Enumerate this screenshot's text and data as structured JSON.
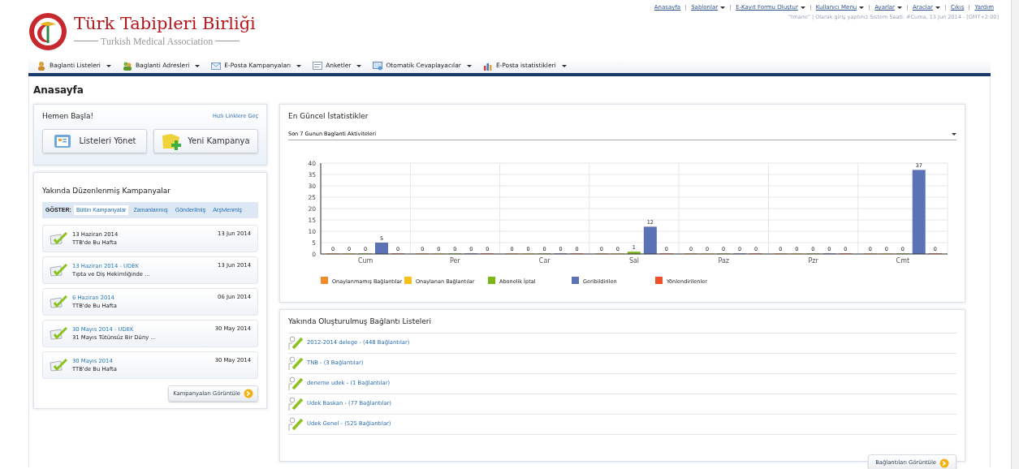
{
  "header": {
    "logo_title": "Türk Tabipleri Birliği",
    "logo_subtitle": "Turkish Medical Association",
    "top_links": [
      {
        "label": "Anasayfa",
        "dropdown": false
      },
      {
        "label": "Sablonlar",
        "dropdown": true
      },
      {
        "label": "E-Kayıt Formu Oluştur",
        "dropdown": true
      },
      {
        "label": "Kullanıcı Menu",
        "dropdown": true
      },
      {
        "label": "Ayarlar",
        "dropdown": true
      },
      {
        "label": "Araclar",
        "dropdown": true
      },
      {
        "label": "Çıkış",
        "dropdown": false
      },
      {
        "label": "Yardım",
        "dropdown": false
      }
    ],
    "session_info": "\"tmane\" | Olarak giriş yaptınız Sistem Saati: #Cuma, 13 Jun 2014 - [GMT+2:00]"
  },
  "nav": [
    {
      "label": "Baglanti Listeleri",
      "kind": "person"
    },
    {
      "label": "Baglanti Adresleri",
      "kind": "people"
    },
    {
      "label": "E-Posta Kampanyaları",
      "kind": "mail"
    },
    {
      "label": "Anketler",
      "kind": "form"
    },
    {
      "label": "Otomatik Cevaplayacılar",
      "kind": "auto"
    },
    {
      "label": "E-Posta istatistikleri",
      "kind": "chart"
    }
  ],
  "page_title": "Anasayfa",
  "quick_start": {
    "title": "Hemen Başla!",
    "link": "Hızlı Linklere Geç",
    "buttons": [
      {
        "label": "Listeleri Yönet",
        "kind": "folder"
      },
      {
        "label": "Yeni Kampanya",
        "kind": "add"
      }
    ]
  },
  "campaigns": {
    "title": "Yakında Düzenlenmiş Kampanyalar",
    "filter_label": "GÖSTER:",
    "filters": [
      {
        "label": "Bütün Kampanyalar",
        "selected": true
      },
      {
        "label": "Zamanlanmış",
        "selected": false
      },
      {
        "label": "Gönderilmiş",
        "selected": false
      },
      {
        "label": "Arşivlenmiş",
        "selected": false
      }
    ],
    "items": [
      {
        "title": "13 Haziran 2014",
        "subtitle": "TTB'de Bu Hafta",
        "date": "13 Jun 2014",
        "linked": false
      },
      {
        "title": "13 Haziran 2014 - UDEK",
        "subtitle": "Tıpta ve Diş Hekimliğinde ...",
        "date": "13 Jun 2014",
        "linked": true
      },
      {
        "title": "6 Haziran 2014",
        "subtitle": "TTB'de Bu Hafta",
        "date": "06 Jun 2014",
        "linked": true
      },
      {
        "title": "30 Mayıs 2014 - UDEK",
        "subtitle": "31 Mayıs Tütünsüz Bir Düny ...",
        "date": "30 May 2014",
        "linked": true
      },
      {
        "title": "30 Mayıs 2014",
        "subtitle": "TTB'de Bu Hafta",
        "date": "30 May 2014",
        "linked": true
      }
    ],
    "button": "Kampanyaları Görüntüle"
  },
  "stats": {
    "title": "En Güncel İstatistikler",
    "select": "Son 7 Gunun Baglanti Aktiviteleri",
    "chart_data": {
      "type": "bar",
      "categories": [
        "Cum",
        "Per",
        "Car",
        "Sal",
        "Paz",
        "Pzr",
        "Cmt"
      ],
      "series": [
        {
          "name": "Onaylanmamış Bağlantılar",
          "color": "#f28c28",
          "values": [
            0,
            0,
            0,
            0,
            0,
            0,
            0
          ]
        },
        {
          "name": "Onaylanan Bağlantılar",
          "color": "#f5c11a",
          "values": [
            0,
            0,
            0,
            0,
            0,
            0,
            0
          ]
        },
        {
          "name": "Abonelik İptal",
          "color": "#7cb518",
          "values": [
            0,
            0,
            0,
            1,
            0,
            0,
            0
          ]
        },
        {
          "name": "Geribildirilen",
          "color": "#5b73b5",
          "values": [
            5,
            0,
            0,
            12,
            0,
            0,
            37
          ]
        },
        {
          "name": "Yönlendirilenler",
          "color": "#f0502a",
          "values": [
            0,
            0,
            0,
            0,
            0,
            0,
            0
          ]
        }
      ],
      "ylim": [
        0,
        40
      ],
      "yticks": [
        0,
        5,
        10,
        15,
        20,
        25,
        30,
        35,
        40
      ],
      "data_labels": true,
      "grid": true,
      "legend": true
    }
  },
  "lists": {
    "title": "Yakında Oluşturulmuş Bağlantı Listeleri",
    "items": [
      "2012-2014 delege - (448 Bağlantılar)",
      "TNB - (3 Bağlantılar)",
      "deneme udek - (1 Bağlantılar)",
      "Udek Baskan - (77 Bağlantılar)",
      "Udek Genel - (525 Bağlantılar)"
    ],
    "button": "Bağlantıları Görüntüle"
  }
}
